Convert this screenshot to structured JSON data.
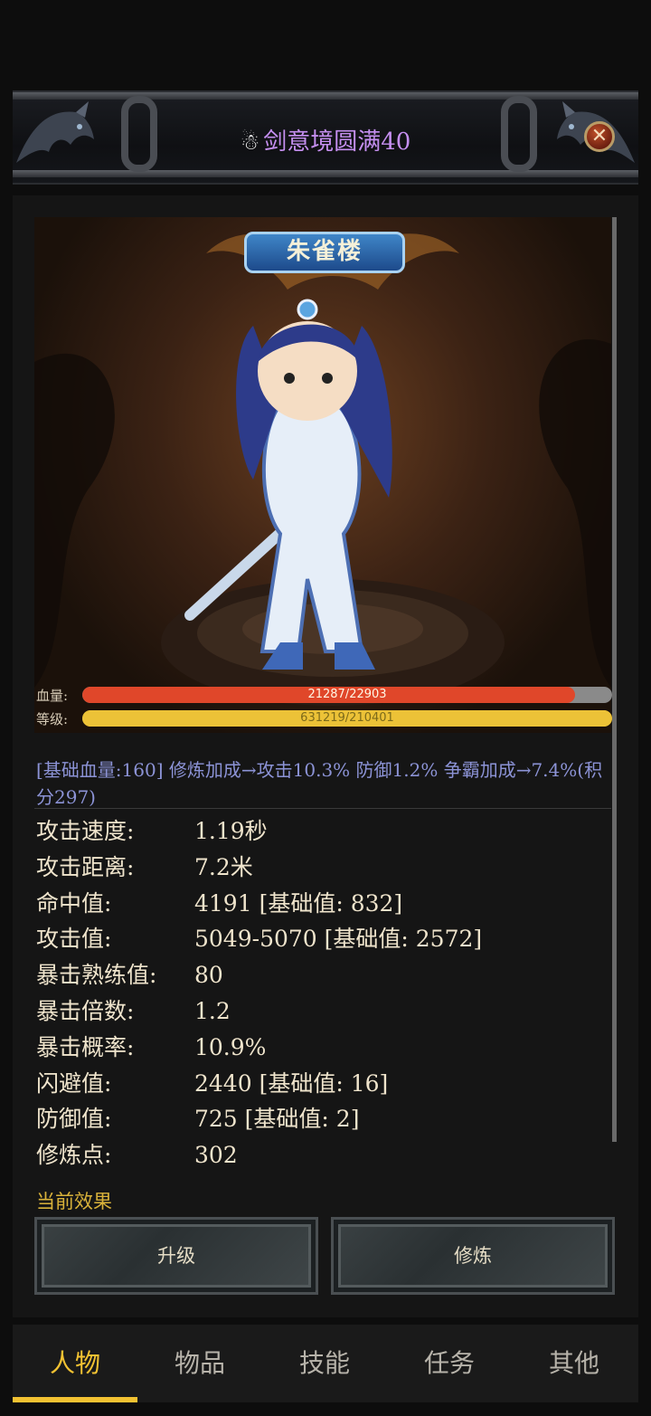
{
  "window": {
    "title_icon": "snowman-icon",
    "title": "剑意境圆满40",
    "close_icon": "close-icon"
  },
  "scene": {
    "location": "朱雀楼"
  },
  "bars": {
    "hp_label": "血量:",
    "hp_text": "21287/22903",
    "hp_current": 21287,
    "hp_max": 22903,
    "hp_color": "#e0472a",
    "exp_label": "等级:",
    "exp_text": "631219/210401",
    "exp_color": "#ecc237"
  },
  "description": "[基础血量:160]  修炼加成→攻击10.3% 防御1.2%  争霸加成→7.4%(积分297)",
  "stats": [
    {
      "label": "攻击速度:",
      "value": "1.19秒"
    },
    {
      "label": "攻击距离:",
      "value": "7.2米"
    },
    {
      "label": "命中值:",
      "value": "4191 [基础值: 832]"
    },
    {
      "label": "攻击值:",
      "value": "5049-5070 [基础值: 2572]"
    },
    {
      "label": "暴击熟练值:",
      "value": "80"
    },
    {
      "label": "暴击倍数:",
      "value": "1.2"
    },
    {
      "label": "暴击概率:",
      "value": "10.9%"
    },
    {
      "label": "闪避值:",
      "value": "2440 [基础值: 16]"
    },
    {
      "label": "防御值:",
      "value": "725 [基础值: 2]"
    },
    {
      "label": "修炼点:",
      "value": "302"
    }
  ],
  "effect_title": "当前效果",
  "buttons": {
    "upgrade": "升级",
    "cultivate": "修炼"
  },
  "tabs": [
    "人物",
    "物品",
    "技能",
    "任务",
    "其他"
  ],
  "active_tab": "人物",
  "colors": {
    "accent": "#f2c232",
    "title": "#c58ff0",
    "description": "#8c93d6"
  }
}
